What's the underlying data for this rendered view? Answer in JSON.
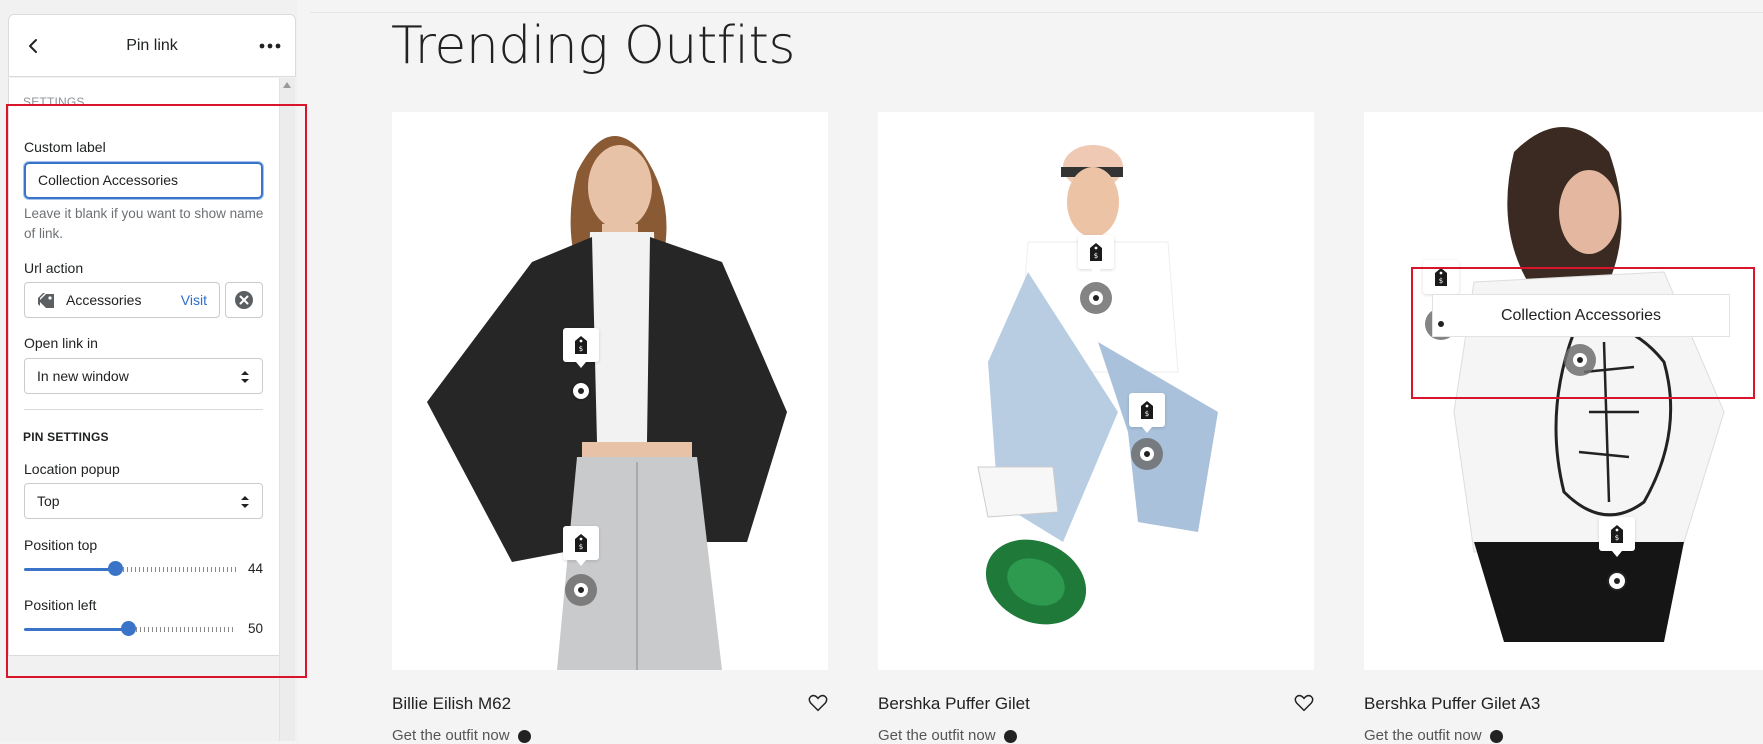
{
  "sidebar": {
    "title": "Pin link",
    "settings_heading": "SETTINGS",
    "custom_label": {
      "label": "Custom label",
      "value": "Collection Accessories",
      "help": "Leave it blank if you want to show name of link."
    },
    "url_action": {
      "label": "Url action",
      "value": "Accessories",
      "visit": "Visit"
    },
    "open_link": {
      "label": "Open link in",
      "value": "In new window"
    },
    "pin_settings_heading": "PIN SETTINGS",
    "location_popup": {
      "label": "Location popup",
      "value": "Top"
    },
    "position_top": {
      "label": "Position top",
      "value": 44
    },
    "position_left": {
      "label": "Position left",
      "value": 50
    }
  },
  "main": {
    "title": "Trending Outfits",
    "cards": [
      {
        "name": "Billie Eilish M62",
        "link": "Get the outfit now"
      },
      {
        "name": "Bershka Puffer Gilet",
        "link": "Get the outfit now"
      },
      {
        "name": "Bershka Puffer Gilet A3",
        "link": "Get the outfit now"
      }
    ],
    "popup_label": "Collection Accessories"
  },
  "colors": {
    "accent": "#3a74c8",
    "highlight": "#d8152b",
    "link": "#2c6ecb"
  },
  "icons": [
    "back-arrow-icon",
    "more-horizontal-icon",
    "tag-icon",
    "clear-icon",
    "select-caret-icon",
    "heart-icon",
    "play-icon",
    "pin-hotspot-icon"
  ]
}
